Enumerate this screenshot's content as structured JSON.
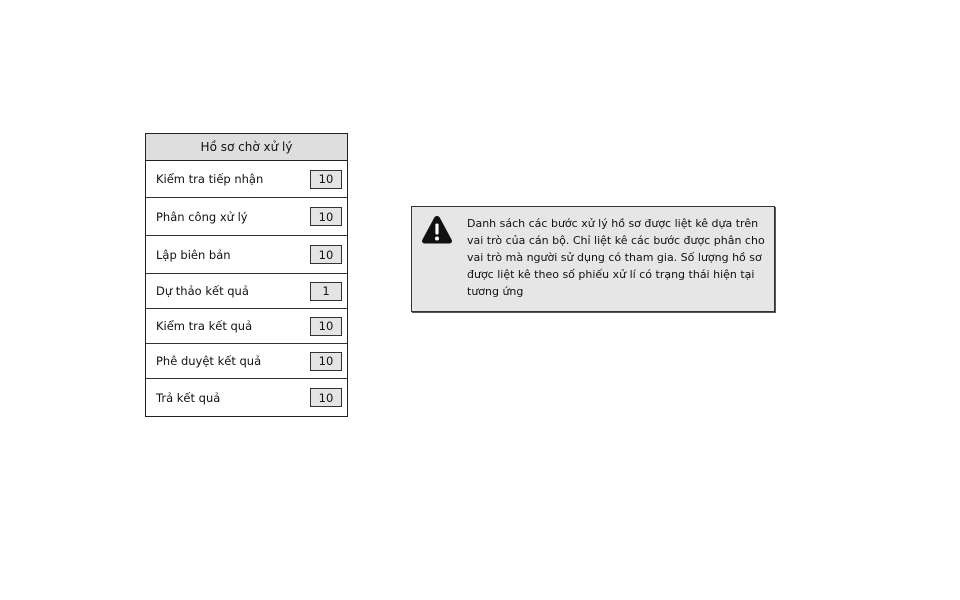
{
  "panel": {
    "title": "Hồ sơ chờ xử lý",
    "steps": [
      {
        "label": "Kiểm tra tiếp nhận",
        "count": "10"
      },
      {
        "label": "Phân công xử lý",
        "count": "10"
      },
      {
        "label": "Lập biên bản",
        "count": "10"
      },
      {
        "label": "Dự thảo kết quả",
        "count": "1"
      },
      {
        "label": "Kiểm tra kết quả",
        "count": "10"
      },
      {
        "label": "Phê duyệt kết quả",
        "count": "10"
      },
      {
        "label": "Trả kết quả",
        "count": "10"
      }
    ]
  },
  "note": {
    "icon": "warning-icon",
    "text": "Danh sách các bước xử lý hồ sơ được liệt kê dựa trên vai trò của cán bộ. Chỉ liệt kê các bước được phân cho vai trò mà người sử dụng có tham gia. Số lượng hồ sơ được liệt kê theo số phiếu xử lí có trạng thái hiện tại tương ứng"
  }
}
